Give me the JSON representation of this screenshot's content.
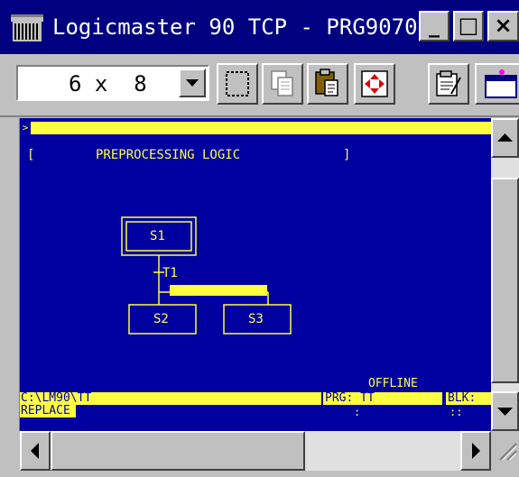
{
  "window": {
    "title": "Logicmaster 90 TCP - PRG9070",
    "minimize_label": "_",
    "maximize_label": "□",
    "close_label": "×"
  },
  "toolbar": {
    "font_size_value": "6 x  8",
    "buttons": [
      "select-icon",
      "copy-icon",
      "paste-icon",
      "navigate-icon",
      "properties-icon",
      "window-icon"
    ]
  },
  "editor": {
    "cmd_prompt": ">",
    "header_open": "[",
    "header_title": "PREPROCESSING LOGIC",
    "header_close": "]",
    "steps": {
      "s1": "S1",
      "s2": "S2",
      "s3": "S3"
    },
    "transition": "T1"
  },
  "status": {
    "offline": "OFFLINE",
    "path": "C:\\LM90\\TT",
    "prg": "PRG: TT",
    "blk": "BLK:",
    "mode": "REPLACE",
    "colon1": ":",
    "colon2": "::"
  },
  "colors": {
    "background": "#0000a0",
    "foreground": "#ffff40",
    "titlebar": "#000080",
    "chrome": "#c0c0c0"
  }
}
